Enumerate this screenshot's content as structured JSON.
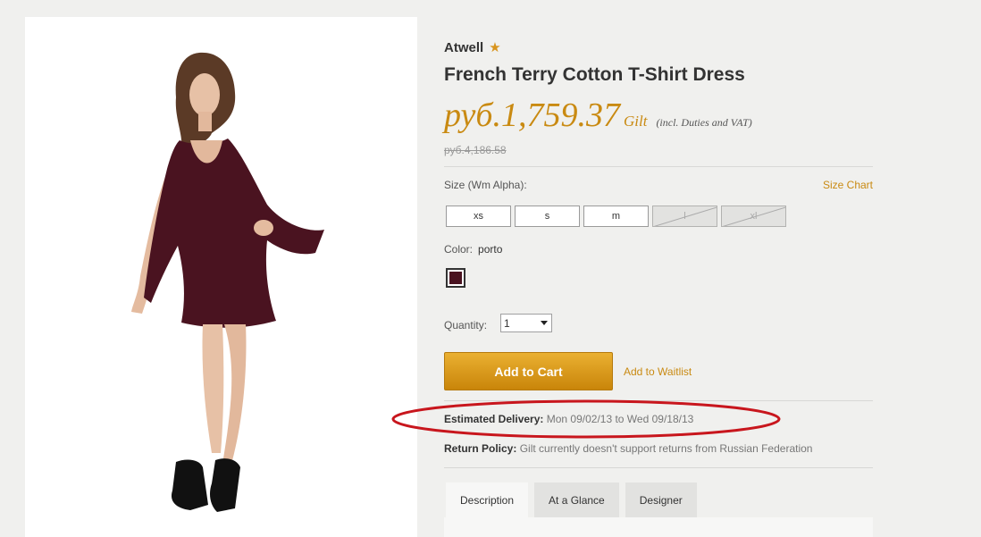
{
  "product": {
    "brand": "Atwell",
    "title": "French Terry Cotton T-Shirt Dress",
    "price": "руб.1,759.37",
    "price_brand": "Gilt",
    "price_note": "(incl. Duties and VAT)",
    "old_price": "руб.4,186.58"
  },
  "size": {
    "label": "Size (Wm Alpha):",
    "chart_link": "Size Chart",
    "options": [
      {
        "label": "xs",
        "available": true
      },
      {
        "label": "s",
        "available": true
      },
      {
        "label": "m",
        "available": true
      },
      {
        "label": "l",
        "available": false
      },
      {
        "label": "xl",
        "available": false
      }
    ]
  },
  "color": {
    "label": "Color:",
    "value": "porto",
    "swatch_hex": "#4a1320"
  },
  "quantity": {
    "label": "Quantity:",
    "value": "1"
  },
  "actions": {
    "add_to_cart": "Add to Cart",
    "waitlist": "Add to Waitlist"
  },
  "delivery": {
    "label": "Estimated Delivery:",
    "value": "Mon 09/02/13 to Wed 09/18/13"
  },
  "return_policy": {
    "label": "Return Policy:",
    "value": "Gilt currently doesn't support returns from Russian Federation"
  },
  "tabs": [
    {
      "label": "Description",
      "active": true
    },
    {
      "label": "At a Glance",
      "active": false
    },
    {
      "label": "Designer",
      "active": false
    }
  ],
  "colors": {
    "accent": "#c98a12",
    "highlight_ellipse": "#c8161d",
    "dress": "#4a1320"
  },
  "icons": {
    "favorite": "star-icon"
  }
}
